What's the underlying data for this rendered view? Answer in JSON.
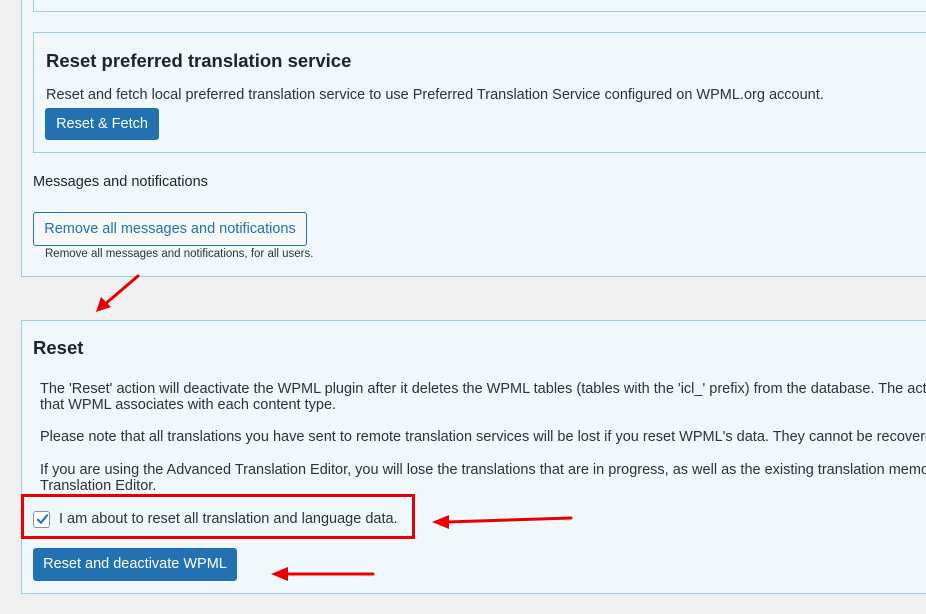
{
  "preferred_service": {
    "title": "Reset preferred translation service",
    "description": "Reset and fetch local preferred translation service to use Preferred Translation Service configured on WPML.org account.",
    "button_label": "Reset & Fetch"
  },
  "messages": {
    "heading": "Messages and notifications",
    "button_label": "Remove all messages and notifications",
    "help_text": "Remove all messages and notifications, for all users."
  },
  "reset": {
    "title": "Reset",
    "paragraph_1_line_1": "The 'Reset' action will deactivate the WPML plugin after it deletes the WPML tables (tables with the 'icl_' prefix) from the database. The act",
    "paragraph_1_line_2": "that WPML associates with each content type.",
    "paragraph_2": "Please note that all translations you have sent to remote translation services will be lost if you reset WPML's data. They cannot be recovere",
    "paragraph_3_line_1": "If you are using the Advanced Translation Editor, you will lose the translations that are in progress, as well as the existing translation memo",
    "paragraph_3_line_2": "Translation Editor.",
    "confirm_label": "I am about to reset all translation and language data.",
    "confirm_checked": true,
    "button_label": "Reset and deactivate WPML"
  },
  "colors": {
    "primary": "#2271b1",
    "panel_bg": "#f0f8fc",
    "panel_border": "#9fcde0",
    "annotation_red": "#e80000"
  },
  "icons": {
    "checkbox_mark": "checkmark-icon",
    "annotation": "red-arrow-icon"
  }
}
